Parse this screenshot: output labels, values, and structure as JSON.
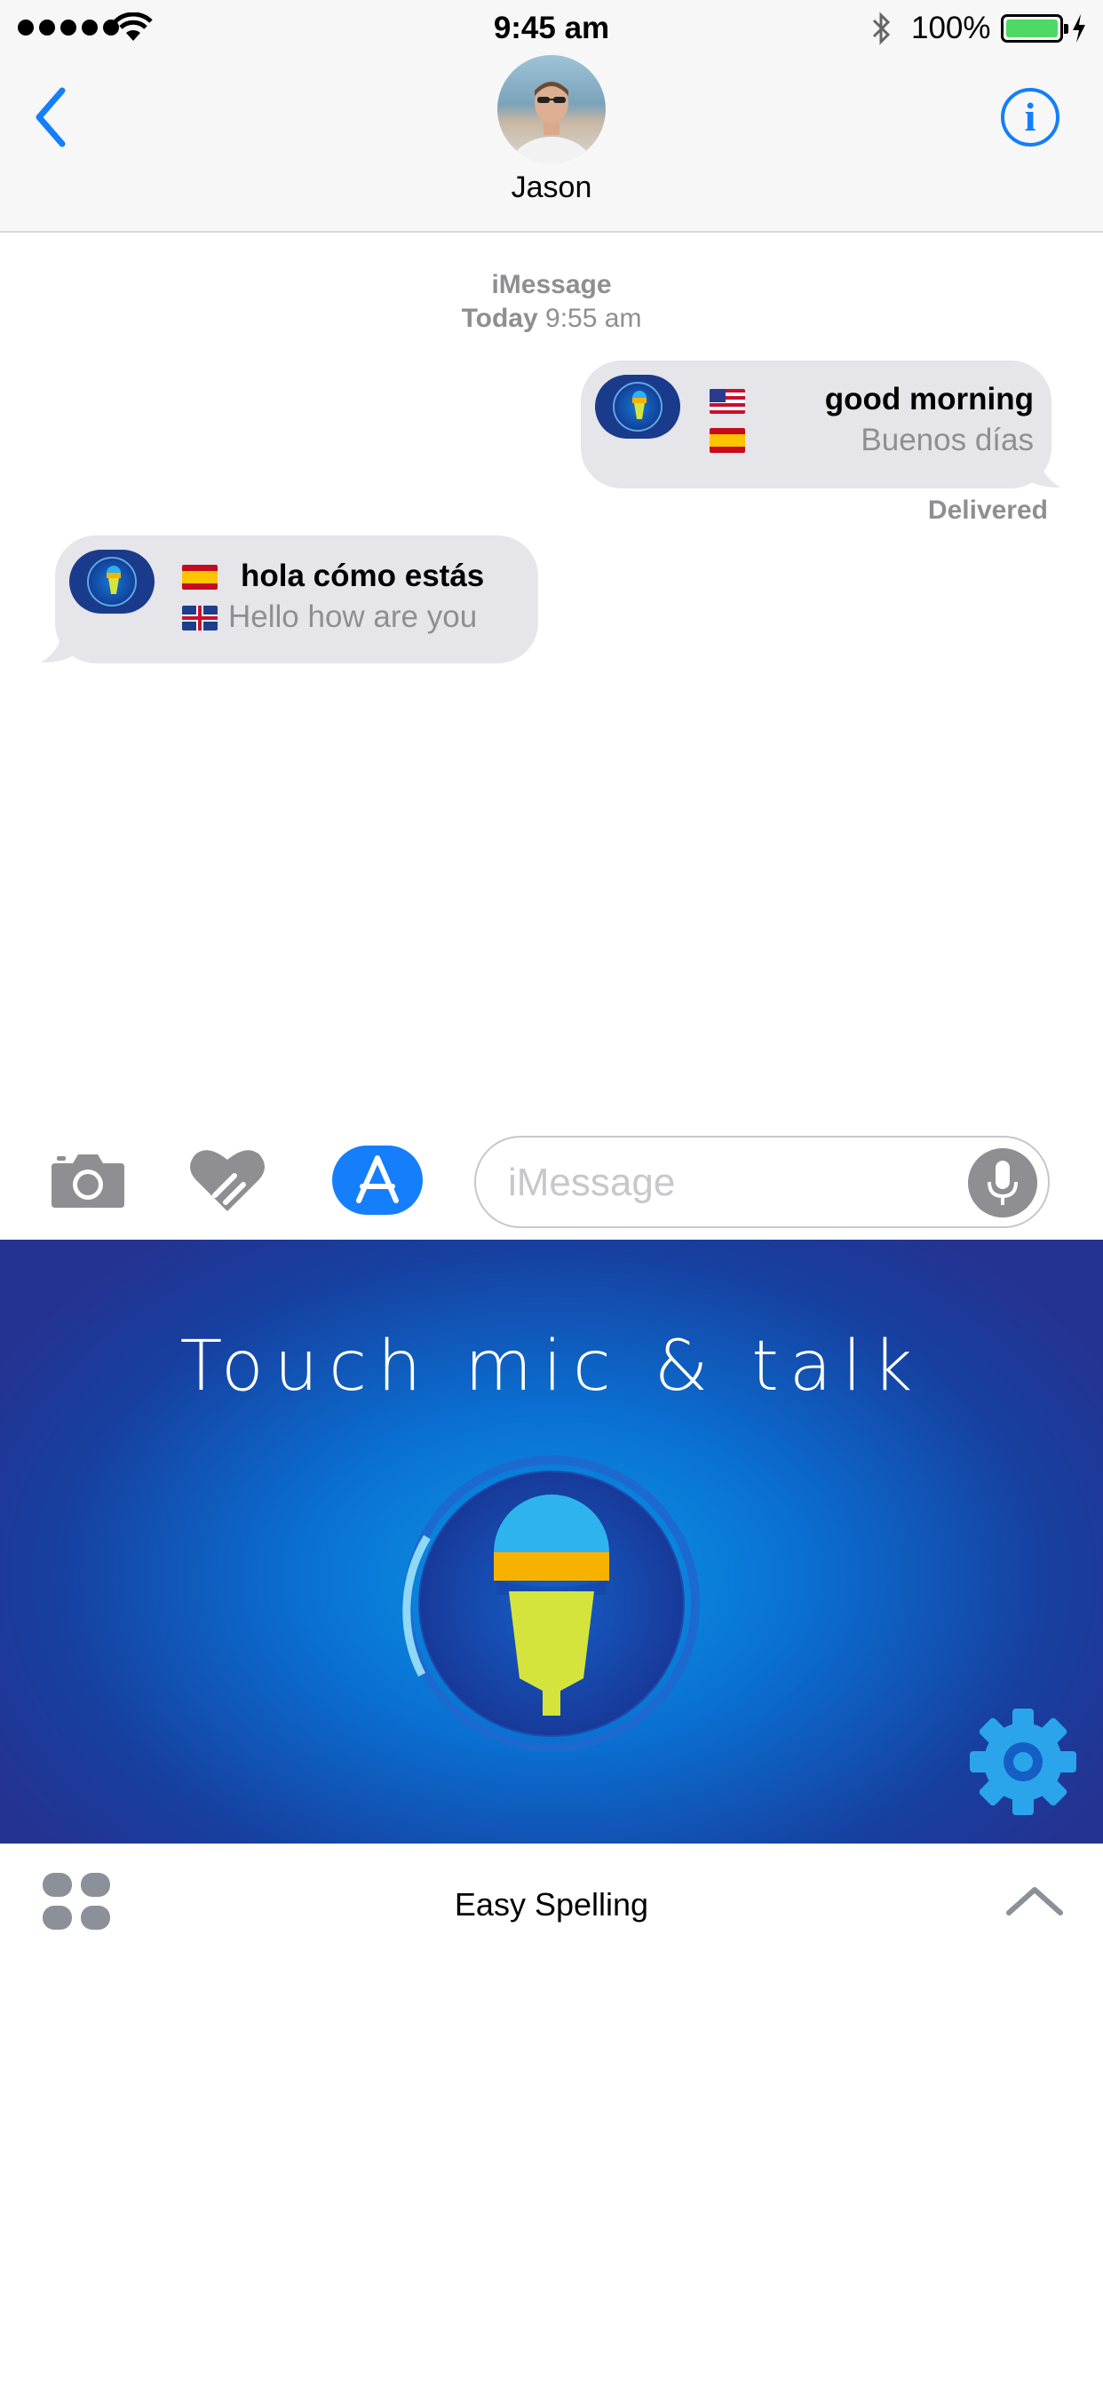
{
  "status_bar": {
    "time": "9:45 am",
    "battery_percent": "100%",
    "battery_level": 1.0,
    "battery_color": "#4cd964"
  },
  "header": {
    "back_icon": "chevron-left-icon",
    "contact_name": "Jason",
    "info_icon_glyph": "i",
    "accent_color": "#157efb"
  },
  "conversation": {
    "service_label": "iMessage",
    "date_label": "Today",
    "time_label": "9:55 am",
    "messages": [
      {
        "direction": "outgoing",
        "original_flag": "us-flag-icon",
        "translated_flag": "spain-flag-icon",
        "original_text": "good morning",
        "translated_text": "Buenos días"
      },
      {
        "direction": "incoming",
        "original_flag": "spain-flag-icon",
        "translated_flag": "uk-flag-icon",
        "original_text": "hola cómo estás",
        "translated_text": "Hello how are you"
      }
    ],
    "delivery_status": "Delivered"
  },
  "toolbar": {
    "camera_icon": "camera-icon",
    "digital_touch_icon": "digital-touch-heart-icon",
    "app_store_icon": "app-store-icon",
    "input_placeholder": "iMessage",
    "input_value": "",
    "dictation_icon": "microphone-icon"
  },
  "app_panel": {
    "title": "Touch mic & talk",
    "mic_button_icon": "microphone-icon",
    "settings_icon": "gear-icon",
    "background_colors": [
      "#0b98e8",
      "#243392"
    ]
  },
  "drawer": {
    "apps_icon": "app-drawer-grid-icon",
    "app_name": "Easy Spelling",
    "expand_icon": "chevron-up-icon"
  }
}
